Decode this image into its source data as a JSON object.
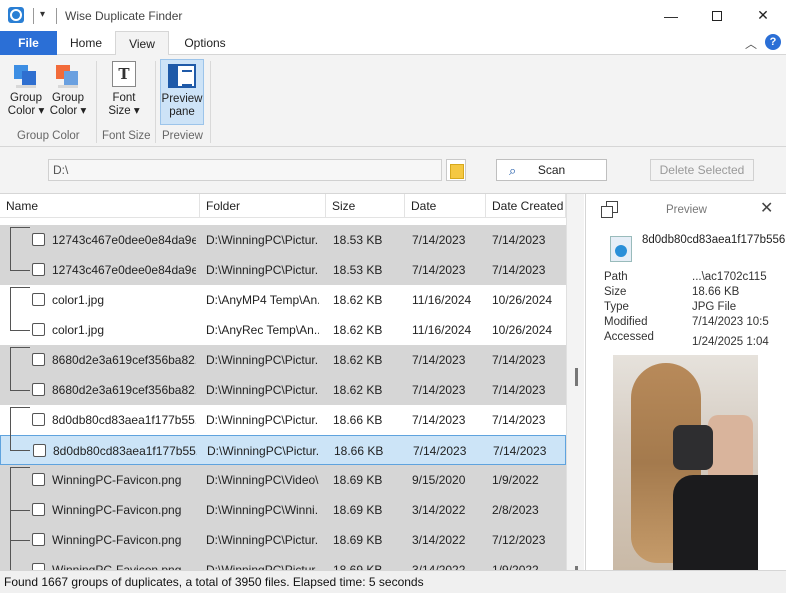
{
  "window": {
    "title": "Wise Duplicate Finder"
  },
  "tabs": {
    "file": "File",
    "home": "Home",
    "view": "View",
    "options": "Options"
  },
  "ribbon": {
    "group_color_1": {
      "line1": "Group",
      "line2": "Color ▾",
      "back_color": "#3d8ee3",
      "front_color": "#2f6fd0"
    },
    "group_color_2": {
      "line1": "Group",
      "line2": "Color ▾",
      "back_color": "#f26b3a",
      "front_color": "#6aa0e0"
    },
    "font_size": {
      "line1": "Font",
      "line2": "Size ▾",
      "glyph": "T"
    },
    "preview_pane": {
      "line1": "Preview",
      "line2": "pane"
    },
    "group_labels": {
      "group_color": "Group Color",
      "font_size": "Font Size",
      "preview": "Preview"
    }
  },
  "path_bar": {
    "path": "D:\\",
    "scan_label": "Scan",
    "delete_label": "Delete Selected"
  },
  "table": {
    "headers": {
      "name": "Name",
      "folder": "Folder",
      "size": "Size",
      "modified": "Date Modified",
      "created": "Date Created"
    },
    "rows": [
      {
        "name": "12743c467e0dee0e84da9e...",
        "folder": "D:\\WinningPC\\Pictur...",
        "size": "18.53 KB",
        "modified": "7/14/2023",
        "created": "7/14/2023",
        "style": "grey"
      },
      {
        "name": "12743c467e0dee0e84da9e...",
        "folder": "D:\\WinningPC\\Pictur...",
        "size": "18.53 KB",
        "modified": "7/14/2023",
        "created": "7/14/2023",
        "style": "grey"
      },
      {
        "name": "color1.jpg",
        "folder": "D:\\AnyMP4 Temp\\An...",
        "size": "18.62 KB",
        "modified": "11/16/2024",
        "created": "10/26/2024",
        "style": "white"
      },
      {
        "name": "color1.jpg",
        "folder": "D:\\AnyRec Temp\\An...",
        "size": "18.62 KB",
        "modified": "11/16/2024",
        "created": "10/26/2024",
        "style": "white"
      },
      {
        "name": "8680d2e3a619cef356ba82...",
        "folder": "D:\\WinningPC\\Pictur...",
        "size": "18.62 KB",
        "modified": "7/14/2023",
        "created": "7/14/2023",
        "style": "grey"
      },
      {
        "name": "8680d2e3a619cef356ba82...",
        "folder": "D:\\WinningPC\\Pictur...",
        "size": "18.62 KB",
        "modified": "7/14/2023",
        "created": "7/14/2023",
        "style": "grey"
      },
      {
        "name": "8d0db80cd83aea1f177b55...",
        "folder": "D:\\WinningPC\\Pictur...",
        "size": "18.66 KB",
        "modified": "7/14/2023",
        "created": "7/14/2023",
        "style": "white"
      },
      {
        "name": "8d0db80cd83aea1f177b55...",
        "folder": "D:\\WinningPC\\Pictur...",
        "size": "18.66 KB",
        "modified": "7/14/2023",
        "created": "7/14/2023",
        "style": "selected"
      },
      {
        "name": "WinningPC-Favicon.png",
        "folder": "D:\\WinningPC\\Video\\...",
        "size": "18.69 KB",
        "modified": "9/15/2020",
        "created": "1/9/2022",
        "style": "grey"
      },
      {
        "name": "WinningPC-Favicon.png",
        "folder": "D:\\WinningPC\\Winni...",
        "size": "18.69 KB",
        "modified": "3/14/2022",
        "created": "2/8/2023",
        "style": "grey"
      },
      {
        "name": "WinningPC-Favicon.png",
        "folder": "D:\\WinningPC\\Pictur...",
        "size": "18.69 KB",
        "modified": "3/14/2022",
        "created": "7/12/2023",
        "style": "grey"
      },
      {
        "name": "WinningPC-Favicon.png",
        "folder": "D:\\WinningPC\\Pictur...",
        "size": "18.69 KB",
        "modified": "3/14/2022",
        "created": "1/9/2022",
        "style": "grey"
      }
    ]
  },
  "preview": {
    "title": "Preview",
    "filename": "8d0db80cd83aea1f177b556",
    "path_label": "Path",
    "path_value": "...\\ac1702c115",
    "size_label": "Size",
    "size_value": "18.66 KB",
    "type_label": "Type",
    "type_value": "JPG File",
    "modified_label": "Modified",
    "modified_value": "7/14/2023 10:5",
    "accessed_label": "Accessed",
    "accessed_value": "1/24/2025 1:04"
  },
  "status": {
    "text": "Found 1667 groups of duplicates, a total of 3950 files. Elapsed time: 5 seconds"
  }
}
